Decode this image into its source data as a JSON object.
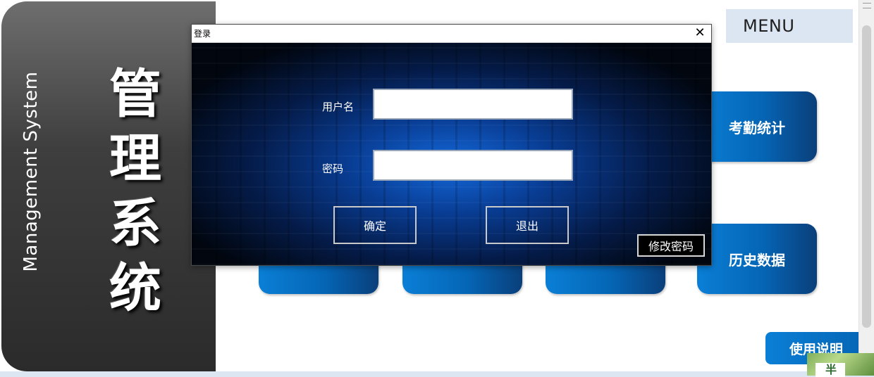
{
  "sidebar": {
    "english_title": "Management System",
    "chinese_title": [
      "管",
      "理",
      "系",
      "统"
    ]
  },
  "menu": {
    "header": "MENU",
    "tiles": [
      {
        "label": "考勤统计"
      },
      {
        "label": "历史数据"
      }
    ],
    "help_button": "使用说明"
  },
  "dialog": {
    "title": "登录",
    "close_symbol": "✕",
    "username_label": "用户名",
    "username_value": "",
    "password_label": "密码",
    "password_value": "",
    "confirm_button": "确定",
    "exit_button": "退出",
    "change_password_button": "修改密码"
  },
  "corner_badge": "半",
  "colors": {
    "tile_blue": "#0565b5",
    "menu_bg": "#dce6f2",
    "sidebar_dark": "#2b2b2b"
  }
}
